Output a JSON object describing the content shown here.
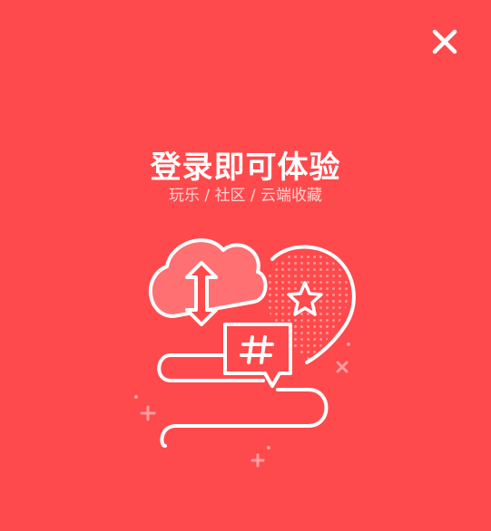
{
  "dialog": {
    "close_icon": "close-icon",
    "title": "登录即可体验",
    "subtitle": "玩乐 / 社区 / 云端收藏",
    "illustration_icons": [
      "cloud-sync-icon",
      "location-star-icon",
      "hashtag-chat-icon"
    ]
  },
  "colors": {
    "background": "#fe4a4c",
    "foreground": "#ffffff",
    "subtitle": "#ffd3d3"
  }
}
